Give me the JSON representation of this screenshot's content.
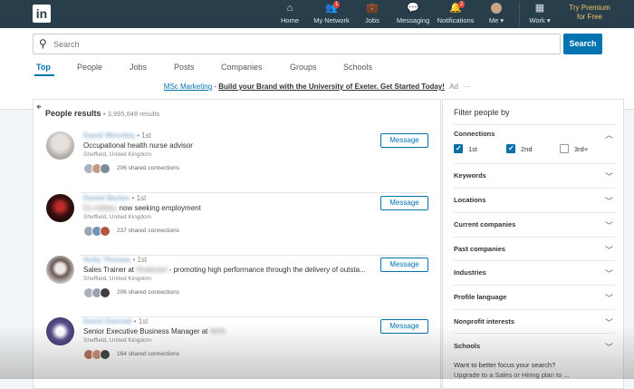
{
  "nav": {
    "logo": "in",
    "items": [
      {
        "label": "Home",
        "icon": "home-icon",
        "glyph": "⌂",
        "badge": ""
      },
      {
        "label": "My Network",
        "icon": "network-icon",
        "glyph": "👥",
        "badge": "1"
      },
      {
        "label": "Jobs",
        "icon": "briefcase-icon",
        "glyph": "💼",
        "badge": ""
      },
      {
        "label": "Messaging",
        "icon": "messaging-icon",
        "glyph": "💬",
        "badge": ""
      },
      {
        "label": "Notifications",
        "icon": "bell-icon",
        "glyph": "🔔",
        "badge": "2"
      },
      {
        "label": "Me ▾",
        "icon": "avatar-icon",
        "glyph": "",
        "badge": ""
      },
      {
        "label": "Work ▾",
        "icon": "grid-icon",
        "glyph": "▦",
        "badge": ""
      }
    ],
    "premium_line1": "Try Premium",
    "premium_line2": "for Free"
  },
  "search": {
    "placeholder": "Search",
    "button": "Search"
  },
  "tabs": [
    "Top",
    "People",
    "Jobs",
    "Posts",
    "Companies",
    "Groups",
    "Schools"
  ],
  "ad": {
    "link1": "MSc Marketing",
    "dash": " - ",
    "link2": "Build your Brand with the University of Exeter. Get Started Today!",
    "tag": "Ad",
    "more": "···"
  },
  "results": {
    "title": "People results",
    "count": "• 3,995,648 results",
    "items": [
      {
        "name": "David Woodley",
        "degree": "• 1st",
        "headline": "Occupational health nurse advisor",
        "headline_blur": "",
        "headline_tail": "",
        "location": "Sheffield, United Kingdom",
        "shared": "206 shared connections",
        "button": "Message",
        "avatar_color": "#b9b4b0"
      },
      {
        "name": "Daniel Barker",
        "degree": "• 1st",
        "headline": "",
        "headline_blur": "Ex-military",
        "headline_tail": " now seeking employment",
        "location": "Sheffield, United Kingdom",
        "shared": "237 shared connections",
        "button": "Message",
        "avatar_color": "#3a1010"
      },
      {
        "name": "Holly Thomas",
        "degree": "• 1st",
        "headline": "Sales Trainer at ",
        "headline_blur": "Redacted",
        "headline_tail": " - promoting high performance through the delivery of outsta...",
        "location": "Sheffield, United Kingdom",
        "shared": "206 shared connections",
        "button": "Message",
        "avatar_color": "#c8c3c2"
      },
      {
        "name": "David Dannatt",
        "degree": "• 1st",
        "headline": "Senior Executive Business Manager at ",
        "headline_blur": "NHS",
        "headline_tail": "",
        "location": "Sheffield, United Kingdom",
        "shared": "164 shared connections",
        "button": "Message",
        "avatar_color": "#3d3a6a"
      }
    ]
  },
  "filters": {
    "title": "Filter people by",
    "connections_label": "Connections",
    "options": [
      {
        "label": "1st",
        "checked": true
      },
      {
        "label": "2nd",
        "checked": true
      },
      {
        "label": "3rd+",
        "checked": false
      }
    ],
    "sections": [
      "Keywords",
      "Locations",
      "Current companies",
      "Past companies",
      "Industries",
      "Profile language",
      "Nonprofit interests",
      "Schools"
    ],
    "upsell_line1": "Want to better focus your search?",
    "upsell_line2": "Upgrade to a Sales or Hiring plan to ..."
  }
}
